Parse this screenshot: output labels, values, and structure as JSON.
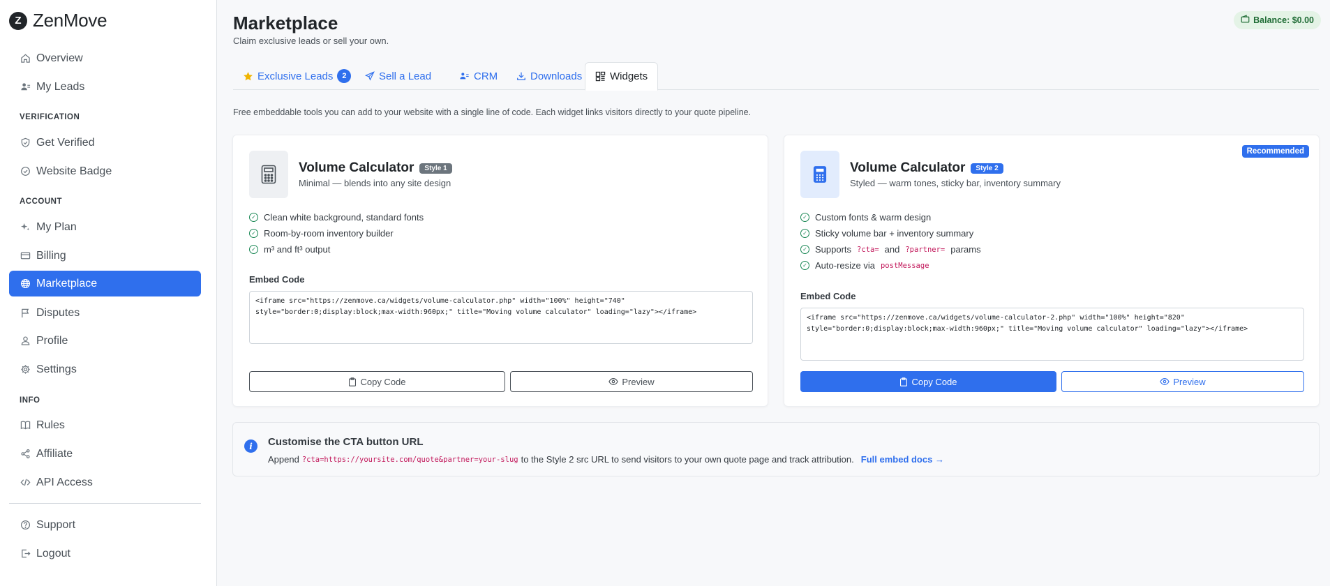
{
  "sidebar": {
    "brand": {
      "logo_letter": "Z",
      "name": "ZenMove"
    },
    "items": [
      {
        "label": "Overview",
        "icon": "home-icon"
      },
      {
        "label": "My Leads",
        "icon": "users-icon"
      },
      {
        "label": "Get Verified",
        "icon": "shield-check-icon"
      },
      {
        "label": "Website Badge",
        "icon": "badge-check-icon"
      },
      {
        "label": "My Plan",
        "icon": "sparkle-icon"
      },
      {
        "label": "Billing",
        "icon": "credit-card-icon"
      },
      {
        "label": "Marketplace",
        "icon": "globe-icon"
      },
      {
        "label": "Disputes",
        "icon": "flag-icon"
      },
      {
        "label": "Profile",
        "icon": "person-icon"
      },
      {
        "label": "Settings",
        "icon": "gear-icon"
      },
      {
        "label": "Rules",
        "icon": "book-icon"
      },
      {
        "label": "Affiliate",
        "icon": "share-icon"
      },
      {
        "label": "API Access",
        "icon": "code-icon"
      },
      {
        "label": "Support",
        "icon": "question-circle-icon"
      },
      {
        "label": "Logout",
        "icon": "logout-icon"
      }
    ],
    "sections": {
      "verification": "VERIFICATION",
      "account": "ACCOUNT",
      "info": "INFO"
    },
    "active": "Marketplace"
  },
  "header": {
    "title": "Marketplace",
    "subtitle": "Claim exclusive leads or sell your own.",
    "balance": "Balance: $0.00"
  },
  "tabs": [
    {
      "label": "Exclusive Leads",
      "icon": "star-icon",
      "badge": "2"
    },
    {
      "label": "Sell a Lead",
      "icon": "send-icon"
    },
    {
      "label": "CRM",
      "icon": "people-icon"
    },
    {
      "label": "Downloads",
      "icon": "download-icon"
    },
    {
      "label": "Widgets",
      "icon": "widgets-icon",
      "active": true
    }
  ],
  "intro": "Free embeddable tools you can add to your website with a single line of code. Each widget links visitors directly to your quote pipeline.",
  "widgets": [
    {
      "title": "Volume Calculator",
      "style": "Style 1",
      "description": "Minimal — blends into any site design",
      "features": [
        "Clean white background, standard fonts",
        "Room-by-room inventory builder",
        "m³ and ft³ output"
      ],
      "embed_label": "Embed Code",
      "embed_code": "<iframe src=\"https://zenmove.ca/widgets/volume-calculator.php\" width=\"100%\" height=\"740\"\nstyle=\"border:0;display:block;max-width:960px;\" title=\"Moving volume calculator\" loading=\"lazy\"></iframe>",
      "copy_label": "Copy Code",
      "preview_label": "Preview"
    },
    {
      "title": "Volume Calculator",
      "style": "Style 2",
      "recommended": "Recommended",
      "description": "Styled — warm tones, sticky bar, inventory summary",
      "features": {
        "f1": "Custom fonts & warm design",
        "f2": "Sticky volume bar + inventory summary",
        "f3_pre": "Supports",
        "f3_code1": "?cta=",
        "f3_mid": "and",
        "f3_code2": "?partner=",
        "f3_post": "params",
        "f4_pre": "Auto-resize via",
        "f4_code": "postMessage"
      },
      "embed_label": "Embed Code",
      "embed_code": "<iframe src=\"https://zenmove.ca/widgets/volume-calculator-2.php\" width=\"100%\" height=\"820\"\nstyle=\"border:0;display:block;max-width:960px;\" title=\"Moving volume calculator\" loading=\"lazy\"></iframe>",
      "copy_label": "Copy Code",
      "preview_label": "Preview"
    }
  ],
  "info": {
    "title": "Customise the CTA button URL",
    "text_pre": "Append",
    "code": "?cta=https://yoursite.com/quote&partner=your-slug",
    "text_post": "to the Style 2 src URL to send visitors to your own quote page and track attribution.",
    "link": "Full embed docs →"
  },
  "colors": {
    "primary": "#2f6fed",
    "success": "#198754",
    "code": "#c2185b",
    "balance_bg": "#e4f3e6"
  }
}
